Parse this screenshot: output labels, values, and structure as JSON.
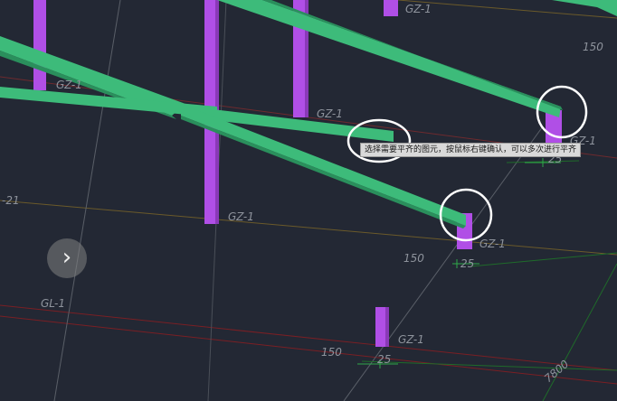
{
  "tooltip": {
    "text": "选择需要平齐的图元，按鼠标右键确认，可以多次进行平齐"
  },
  "labels": {
    "gz": "GZ-1",
    "gl": "GL-1",
    "grid_minus21": "-21",
    "dim_150": "150",
    "dim_25": "25",
    "dim_7800": "7800"
  },
  "nav": {
    "next_icon": "chevron-right-icon"
  },
  "colors": {
    "background": "#232834",
    "beam": "#3dbb7a",
    "column": "#b04fe6",
    "highlight_ring": "#ffffff",
    "axis_red": "#7a1f24",
    "axis_orange": "#a0622a",
    "dim_green": "#2fa84a"
  }
}
